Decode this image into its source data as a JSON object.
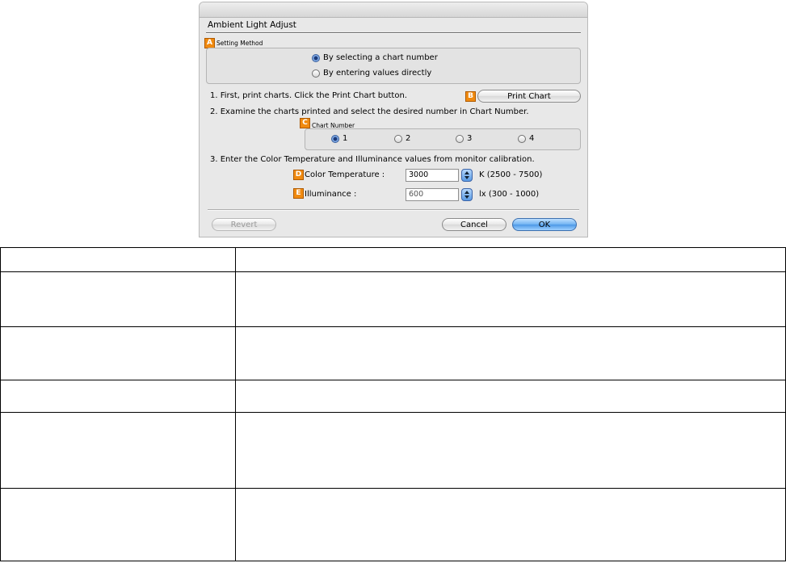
{
  "dialog": {
    "title": "Ambient Light Adjust",
    "setting_method": {
      "badge": "A",
      "label": "Setting Method",
      "options": [
        {
          "label": "By selecting a chart number",
          "checked": true
        },
        {
          "label": "By entering values directly",
          "checked": false
        }
      ]
    },
    "steps": {
      "step1": "1. First, print charts. Click the Print Chart button.",
      "step2": "2. Examine the charts printed and select the desired number in Chart Number.",
      "step3": "3. Enter the Color Temperature and Illuminance values from monitor calibration."
    },
    "print_chart": {
      "badge": "B",
      "label": "Print Chart"
    },
    "chart_number": {
      "badge": "C",
      "label": "Chart Number",
      "options": [
        {
          "label": "1",
          "checked": true
        },
        {
          "label": "2",
          "checked": false
        },
        {
          "label": "3",
          "checked": false
        },
        {
          "label": "4",
          "checked": false
        }
      ]
    },
    "color_temperature": {
      "badge": "D",
      "label": "Color Temperature :",
      "value": "3000",
      "range": "K (2500 - 7500)"
    },
    "illuminance": {
      "badge": "E",
      "label": "Illuminance :",
      "value": "600",
      "range": "lx (300 - 1000)"
    },
    "buttons": {
      "revert": "Revert",
      "cancel": "Cancel",
      "ok": "OK"
    }
  },
  "table": {
    "rows": 6
  },
  "colors": {
    "badge": "#f08a10",
    "default_button": "#6fb2f2"
  },
  "icons": [
    "radio-button-icon",
    "stepper-arrows-icon"
  ]
}
